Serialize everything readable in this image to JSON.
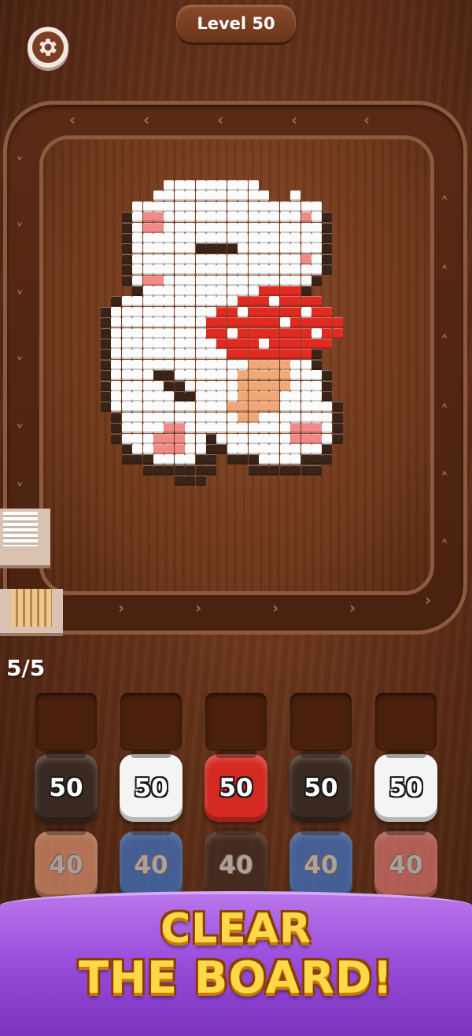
{
  "header": {
    "level_label": "Level 50"
  },
  "counter": {
    "text": "5/5"
  },
  "icons": {
    "settings": "gear-icon"
  },
  "palette": {
    "white": "#fbfbfb",
    "dark": "#3a2418",
    "pink": "#ef8a86",
    "red": "#e02a22",
    "spot": "#ffffff",
    "stem": "#f0a878"
  },
  "spools_front": [
    {
      "color": "#3a2a22",
      "count": "50"
    },
    {
      "color": "#f4f4f4",
      "count": "50"
    },
    {
      "color": "#d42a22",
      "count": "50"
    },
    {
      "color": "#3a2a22",
      "count": "50"
    },
    {
      "color": "#f4f4f4",
      "count": "50"
    }
  ],
  "spools_back": [
    {
      "color": "#e89a78",
      "count": "40"
    },
    {
      "color": "#3a7bd6",
      "count": "40"
    },
    {
      "color": "#3a2a22",
      "count": "40"
    },
    {
      "color": "#3a7bd6",
      "count": "40"
    },
    {
      "color": "#e37a76",
      "count": "40"
    }
  ],
  "banner": {
    "line1": "CLEAR",
    "line2": "THE BOARD!"
  }
}
